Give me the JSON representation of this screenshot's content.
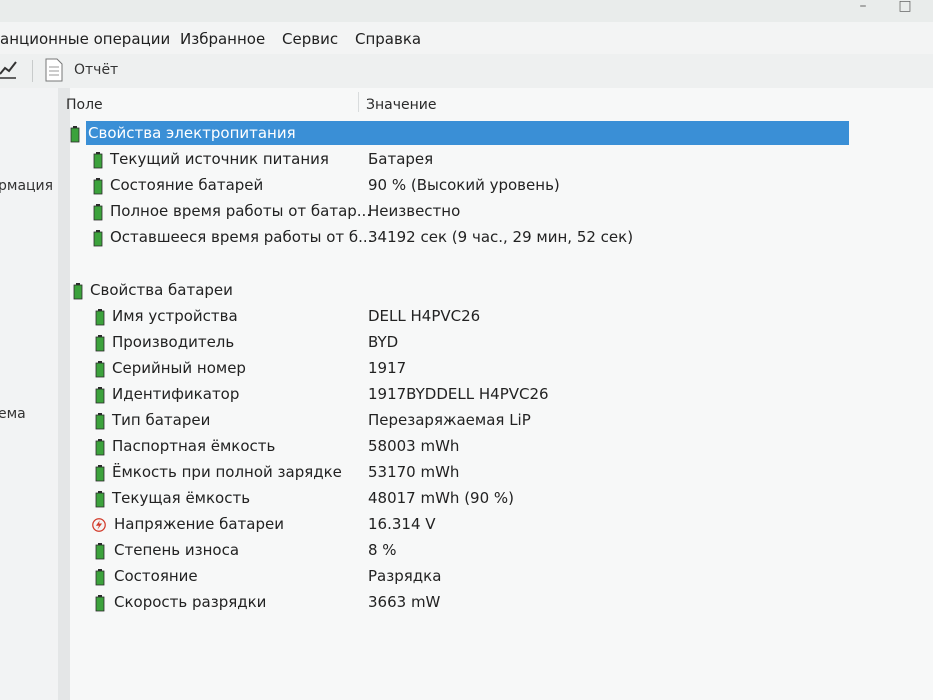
{
  "menubar": {
    "items": [
      "анционные операции",
      "Избранное",
      "Сервис",
      "Справка"
    ]
  },
  "toolbar": {
    "report_label": "Отчёт",
    "icons": [
      "chart-icon",
      "report-icon"
    ]
  },
  "left_pane": {
    "labels": [
      "рмация",
      "ема"
    ]
  },
  "list": {
    "columns": {
      "field": "Поле",
      "value": "Значение"
    },
    "groups": [
      {
        "title": "Свойства электропитания",
        "selected": true,
        "rows": [
          {
            "field": "Текущий источник питания",
            "value": "Батарея"
          },
          {
            "field": "Состояние батарей",
            "value": "90 % (Высокий уровень)"
          },
          {
            "field": "Полное время работы от батар...",
            "value": "Неизвестно"
          },
          {
            "field": "Оставшееся время работы от б...",
            "value": "34192 сек (9 час., 29 мин, 52 сек)"
          }
        ]
      },
      {
        "title": "Свойства батареи",
        "selected": false,
        "rows": [
          {
            "field": "Имя устройства",
            "value": "DELL H4PVC26"
          },
          {
            "field": "Производитель",
            "value": "BYD"
          },
          {
            "field": "Серийный номер",
            "value": "1917"
          },
          {
            "field": "Идентификатор",
            "value": "1917BYDDELL H4PVC26"
          },
          {
            "field": "Тип батареи",
            "value": "Перезаряжаемая LiP"
          },
          {
            "field": "Паспортная ёмкость",
            "value": "58003 mWh"
          },
          {
            "field": "Ёмкость при полной зарядке",
            "value": "53170 mWh"
          },
          {
            "field": "Текущая ёмкость",
            "value": "48017 mWh  (90 %)"
          },
          {
            "field": "Напряжение батареи",
            "value": "16.314 V",
            "icon": "voltage-icon"
          },
          {
            "field": "Степень износа",
            "value": "8 %"
          },
          {
            "field": "Состояние",
            "value": "Разрядка"
          },
          {
            "field": "Скорость разрядки",
            "value": "3663 mW"
          }
        ]
      }
    ]
  },
  "colors": {
    "selection": "#3a8fd6",
    "battery_icon_green": "#3ca23c",
    "voltage_icon_red": "#d23a2a"
  }
}
